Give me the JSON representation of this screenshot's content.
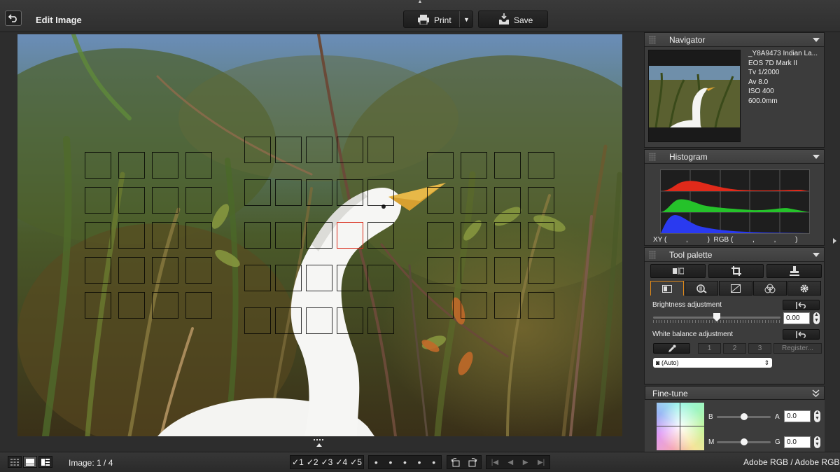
{
  "window": {
    "title": "Edit Image",
    "print_label": "Print",
    "save_label": "Save"
  },
  "af_points": {
    "active_index": "center-middle"
  },
  "navigator": {
    "title": "Navigator",
    "info": [
      "_Y8A9473 Indian La...",
      "EOS 7D Mark II",
      "Tv 1/2000",
      "Av 8.0",
      "ISO 400",
      "600.0mm"
    ]
  },
  "histogram": {
    "title": "Histogram",
    "readout": "XY (          ,          )  RGB (          ,          ,          )",
    "colors": {
      "red": "#e02a1a",
      "green": "#25c22a",
      "blue": "#2a3af0"
    }
  },
  "tool_palette": {
    "title": "Tool palette",
    "brightness_label": "Brightness adjustment",
    "brightness_value": "0.00",
    "brightness_level": 0.5,
    "wb_label": "White balance adjustment",
    "wb_buttons": [
      "1",
      "2",
      "3",
      "Register..."
    ],
    "wb_select": "(Auto)",
    "accent": "#e08a1a"
  },
  "fine_tune": {
    "title": "Fine-tune",
    "b_label": "B",
    "a_label": "A",
    "a_value": "0.0",
    "m_label": "M",
    "g_label": "G",
    "g_value": "0.0"
  },
  "bottom": {
    "image_count": "Image: 1 / 4",
    "ratings": [
      "1",
      "2",
      "3",
      "4",
      "5"
    ],
    "color_space": "Adobe RGB / Adobe RGB"
  }
}
